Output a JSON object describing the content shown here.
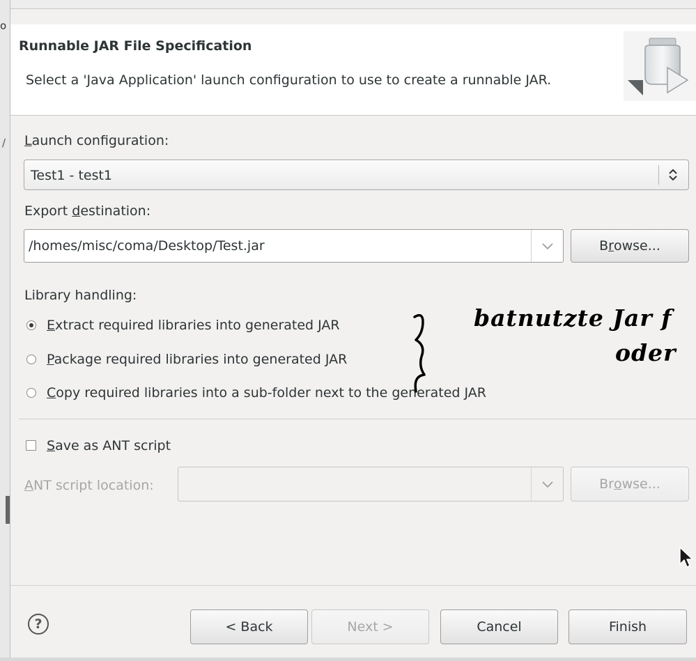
{
  "header": {
    "title": "Runnable JAR File Specification",
    "description": "Select a 'Java Application' launch configuration to use to create a runnable JAR."
  },
  "frame": {
    "glyph_top": "o",
    "glyph_mid": "/"
  },
  "launch": {
    "label_mnemonic": "L",
    "label_rest": "aunch configuration:",
    "selected": "Test1 - test1"
  },
  "export": {
    "label_pre": "Export ",
    "label_mnemonic": "d",
    "label_post": "estination:",
    "value": "/homes/misc/coma/Desktop/Test.jar",
    "browse_pre": "B",
    "browse_mnemonic": "r",
    "browse_post": "owse..."
  },
  "library": {
    "label": "Library handling:",
    "options": [
      {
        "mnemonic": "E",
        "rest": "xtract required libraries into generated JAR",
        "checked": true
      },
      {
        "mnemonic": "P",
        "rest": "ackage required libraries into generated JAR",
        "checked": false
      },
      {
        "mnemonic": "C",
        "rest": "opy required libraries into a sub-folder next to the generated JAR",
        "checked": false
      }
    ]
  },
  "annotation": {
    "line1": "batnutzte Jar f",
    "line2": "oder"
  },
  "ant": {
    "save_mnemonic": "S",
    "save_rest": "ave as ANT script",
    "location_mnemonic": "A",
    "location_rest": "NT script location:",
    "browse_pre": "Br",
    "browse_mnemonic": "o",
    "browse_post": "wse..."
  },
  "buttons": {
    "back": "< Back",
    "next": "Next >",
    "cancel": "Cancel",
    "finish": "Finish",
    "help_glyph": "?"
  },
  "colors": {
    "ink": "#000000",
    "disabled_text": "#a6a6a6",
    "background": "#f2f1f0"
  }
}
